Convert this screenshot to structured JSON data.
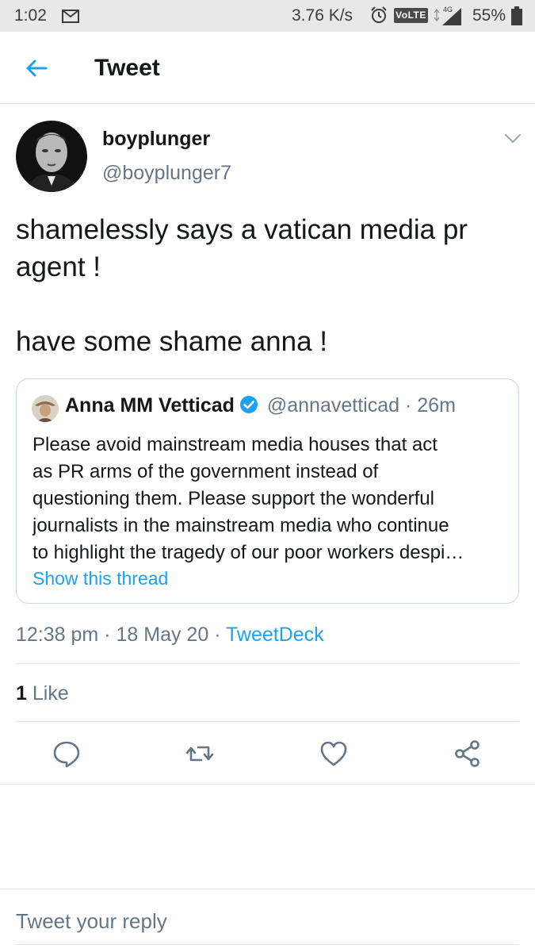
{
  "status_bar": {
    "time": "1:02",
    "network_speed": "3.76 K/s",
    "volte": "VoLTE",
    "network_type": "4G",
    "battery": "55%"
  },
  "header": {
    "back_icon": "arrow-left-icon",
    "title": "Tweet"
  },
  "tweet": {
    "author_name": "boyplunger",
    "author_handle": "@boyplunger7",
    "text_lines": [
      "shamelessly says a vatican media pr",
      "agent !",
      "have some shame anna !"
    ],
    "quoted": {
      "author_name": "Anna MM Vetticad",
      "author_handle": "@annavetticad",
      "separator": "·",
      "age": "26m",
      "body_lines": [
        "Please avoid mainstream media houses that act",
        "as PR arms of the government  instead of",
        "questioning them. Please support the wonderful",
        "journalists in the mainstream media who continue",
        "to highlight the tragedy of our poor workers despi…"
      ],
      "show_thread": "Show this thread"
    },
    "time": "12:38 pm",
    "date": "18 May 20",
    "source": "TweetDeck",
    "dot": "·",
    "likes_count": "1",
    "likes_label": "Like"
  },
  "actions": [
    "reply-icon",
    "retweet-icon",
    "like-icon",
    "share-icon"
  ],
  "reply_placeholder": "Tweet your reply",
  "colors": {
    "accent": "#1da1f2",
    "text": "#14171a",
    "secondary": "#657786",
    "border": "#e1e8ed"
  }
}
